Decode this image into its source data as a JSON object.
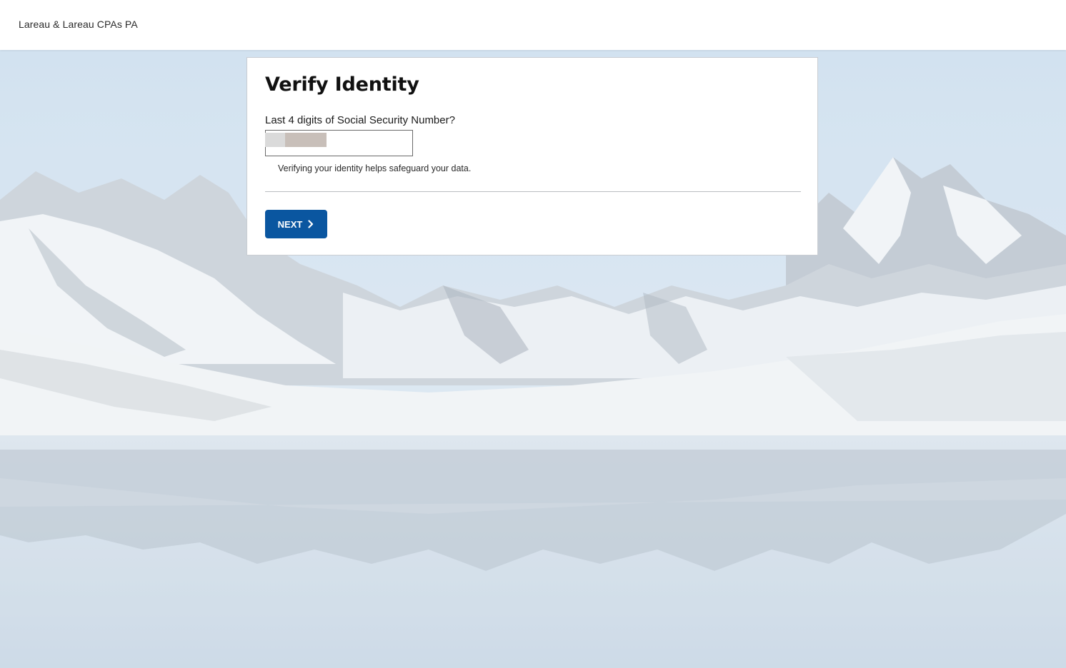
{
  "header": {
    "firm_name": "Lareau & Lareau CPAs PA"
  },
  "card": {
    "title": "Verify Identity",
    "ssn_field": {
      "label": "Last 4 digits of Social Security Number?",
      "value": "",
      "redacted": true
    },
    "helper_text": "Verifying your identity helps safeguard your data.",
    "next_button_label": "NEXT",
    "next_icon": "chevron-right-icon"
  },
  "colors": {
    "primary_button": "#0a56a0",
    "card_background": "#ffffff",
    "header_background": "#ffffff"
  }
}
